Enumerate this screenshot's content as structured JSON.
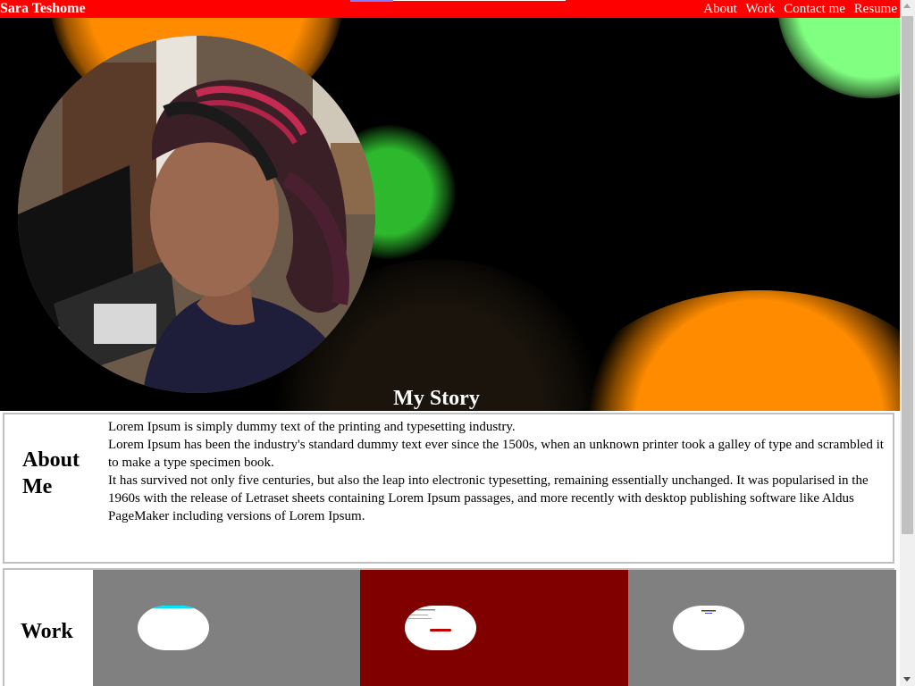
{
  "header": {
    "brand": "Sara Teshome",
    "nav": [
      {
        "label": "About"
      },
      {
        "label": "Work"
      },
      {
        "label": "Contact me"
      },
      {
        "label": "Resume"
      }
    ]
  },
  "hero": {
    "title": "My Story"
  },
  "about": {
    "title": "About Me",
    "paragraphs": [
      "Lorem Ipsum is simply dummy text of the printing and typesetting industry.",
      "Lorem Ipsum has been the industry's standard dummy text ever since the 1500s, when an unknown printer took a galley of type and scrambled it to make a type specimen book.",
      "It has survived not only five centuries, but also the leap into electronic typesetting, remaining essentially unchanged. It was popularised in the 1960s with the release of Letraset sheets containing Lorem Ipsum passages, and more recently with desktop publishing software like Aldus PageMaker including versions of Lorem Ipsum."
    ]
  },
  "work": {
    "title": "Work",
    "cards": [
      {
        "color": "#808080"
      },
      {
        "color": "#800000"
      },
      {
        "color": "#808080"
      }
    ]
  },
  "colors": {
    "header": "#ff0000",
    "accent_orange": "#ff8c00",
    "accent_green": "#80ff80"
  },
  "icons": [
    "scroll-up-arrow-icon",
    "scroll-down-arrow-icon"
  ]
}
